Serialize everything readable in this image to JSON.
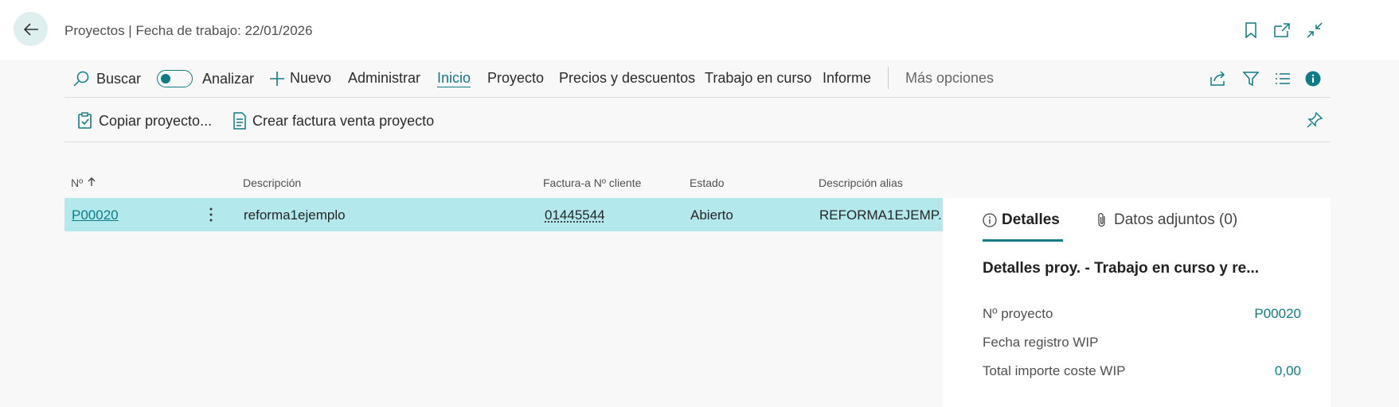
{
  "header": {
    "title": "Proyectos | Fecha de trabajo: 22/01/2026",
    "back_icon": "arrow-left-icon",
    "icons": [
      "bookmark-icon",
      "open-new-window-icon",
      "collapse-icon"
    ]
  },
  "actionbar": {
    "search_label": "Buscar",
    "analyze_label": "Analizar",
    "new_label": "Nuevo",
    "manage_label": "Administrar",
    "home_label": "Inicio",
    "project_label": "Proyecto",
    "prices_label": "Precios y descuentos",
    "wip_label": "Trabajo en curso",
    "report_label": "Informe",
    "more_label": "Más opciones",
    "right_icons": [
      "share-icon",
      "filter-icon",
      "list-view-icon",
      "info-icon"
    ]
  },
  "promoted": {
    "copy_label": "Copiar proyecto...",
    "invoice_label": "Crear factura venta proyecto"
  },
  "table": {
    "columns": [
      "Nº",
      "Descripción",
      "Factura-a Nº cliente",
      "Estado",
      "Descripción alias"
    ],
    "rows": [
      {
        "no": "P00020",
        "description": "reforma1ejemplo",
        "customer": "01445544",
        "status": "Abierto",
        "alias": "REFORMA1EJEMP..."
      }
    ]
  },
  "factbox": {
    "tab_details": "Detalles",
    "tab_attachments": "Datos adjuntos (0)",
    "title": "Detalles proy. - Trabajo en curso y re...",
    "fields": [
      {
        "label": "Nº proyecto",
        "value": "P00020"
      },
      {
        "label": "Fecha registro WIP",
        "value": ""
      },
      {
        "label": "Total importe coste WIP",
        "value": "0,00"
      }
    ]
  },
  "colors": {
    "accent": "#0f7b84",
    "selected_row": "#b3e8ec",
    "back_button_bg": "#dfeff0"
  }
}
